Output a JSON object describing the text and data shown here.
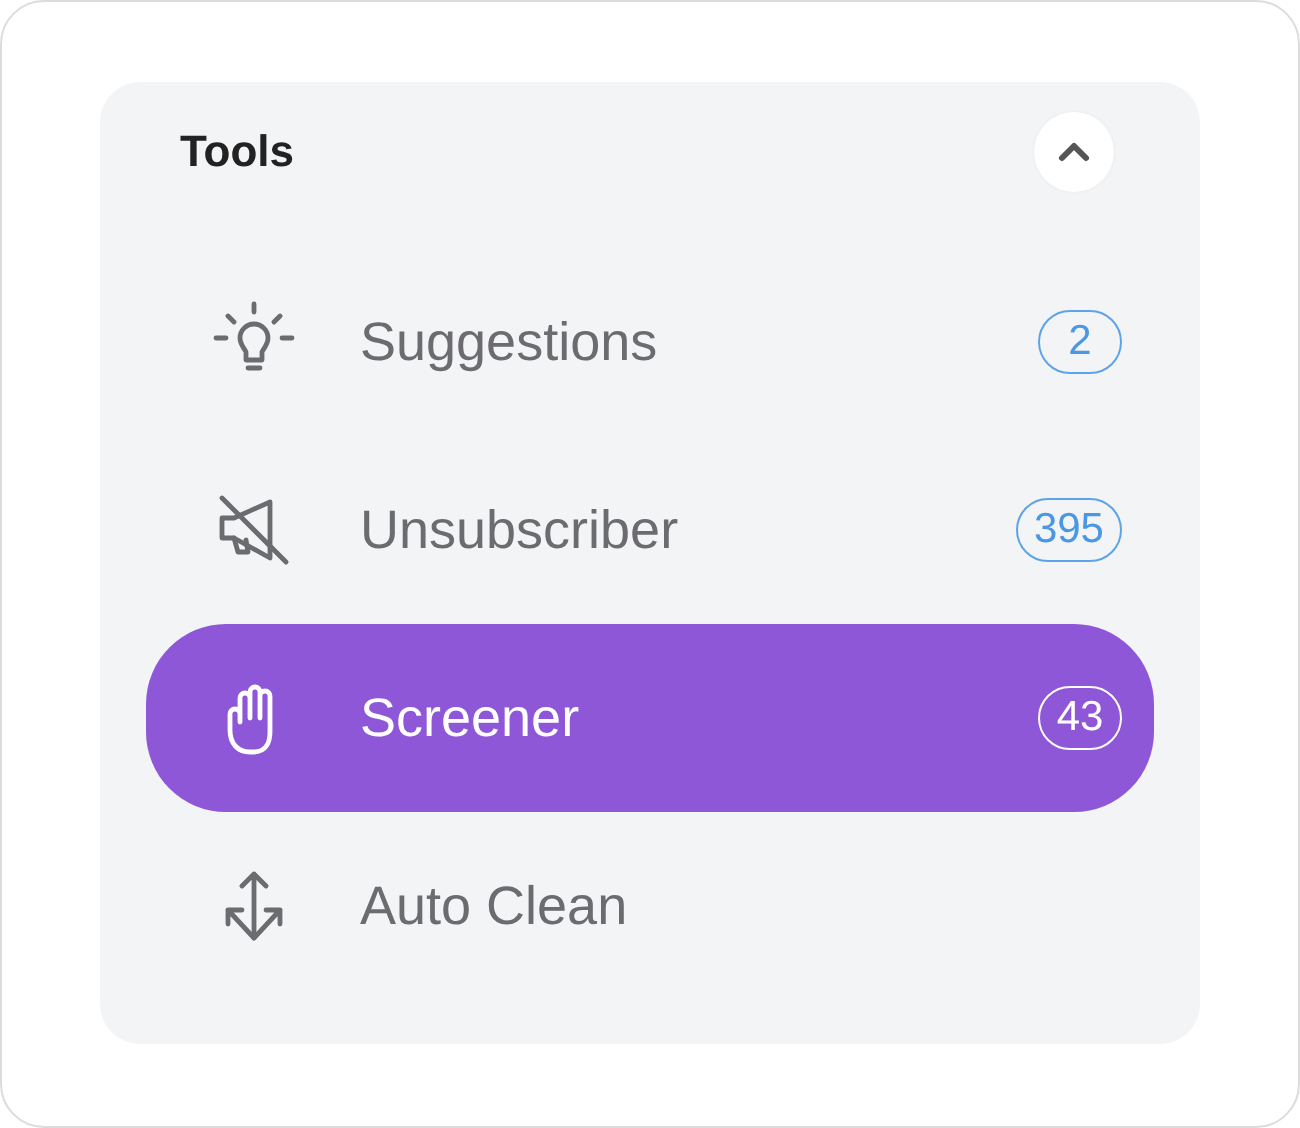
{
  "panel": {
    "title": "Tools",
    "expanded": true
  },
  "items": [
    {
      "kind": "bulb",
      "label": "Suggestions",
      "badge": "2",
      "selected": false
    },
    {
      "kind": "muted",
      "label": "Unsubscriber",
      "badge": "395",
      "selected": false
    },
    {
      "kind": "hand",
      "label": "Screener",
      "badge": "43",
      "selected": true
    },
    {
      "kind": "arrows",
      "label": "Auto Clean",
      "selected": false
    }
  ]
}
